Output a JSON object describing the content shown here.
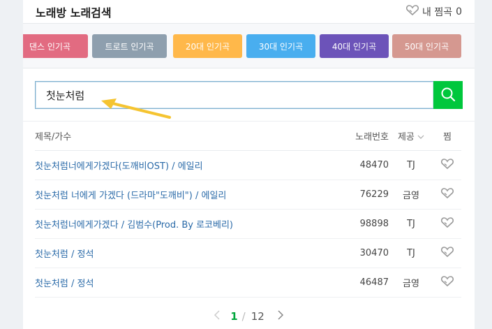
{
  "header": {
    "title": "노래방 노래검색",
    "fav_label": "내 찜곡",
    "fav_count": "0"
  },
  "categories": [
    {
      "label": "댄스 인기곡",
      "color": "#e26b81"
    },
    {
      "label": "트로트 인기곡",
      "color": "#8e9fae"
    },
    {
      "label": "20대 인기곡",
      "color": "#ffb84a"
    },
    {
      "label": "30대 인기곡",
      "color": "#49aeef"
    },
    {
      "label": "40대 인기곡",
      "color": "#6c53b9"
    },
    {
      "label": "50대 인기곡",
      "color": "#d59890"
    }
  ],
  "search": {
    "value": "첫눈처럼"
  },
  "table": {
    "headers": {
      "title": "제목/가수",
      "number": "노래번호",
      "provider": "제공",
      "like": "찜"
    },
    "rows": [
      {
        "title": "첫눈처럼너에게가겠다(도깨비OST) / 에일리",
        "number": "48470",
        "provider": "TJ"
      },
      {
        "title": "첫눈처럼 너에게 가겠다 (드라마\"도깨비\") / 에일리",
        "number": "76229",
        "provider": "금영"
      },
      {
        "title": "첫눈처럼너에게가겠다 / 김범수(Prod. By 로코베리)",
        "number": "98898",
        "provider": "TJ"
      },
      {
        "title": "첫눈처럼 / 정석",
        "number": "30470",
        "provider": "TJ"
      },
      {
        "title": "첫눈처럼 / 정석",
        "number": "46487",
        "provider": "금영"
      }
    ]
  },
  "pagination": {
    "current": "1",
    "separator": "/",
    "total": "12"
  },
  "colors": {
    "accent": "#00c73c",
    "link": "#2a6aa8",
    "annotation_arrow": "#f5c431"
  }
}
